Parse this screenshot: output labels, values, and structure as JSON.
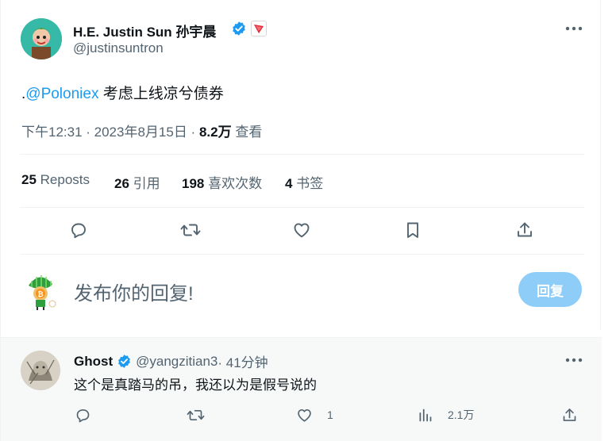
{
  "tweet": {
    "author_name": "H.E. Justin Sun 孙宇晨",
    "handle": "@justinsuntron",
    "text_prefix": ".",
    "mention": "@Poloniex",
    "text_rest": " 考虑上线凉兮债券",
    "time": "下午12:31 · 2023年8月15日 · ",
    "views_count": "8.2万",
    "views_label": " 查看",
    "more_icon": "more-horizontal-icon",
    "verified_color": "#1d9bf0",
    "affiliate_color": "#e5202e"
  },
  "stats": {
    "reposts_count": "25",
    "reposts_label": " Reposts",
    "quotes_count": "26",
    "quotes_label": " 引用",
    "likes_count": "198",
    "likes_label": " 喜欢次数",
    "bookmarks_count": "4",
    "bookmarks_label": " 书签"
  },
  "actions": [
    "reply-icon",
    "retweet-icon",
    "like-icon",
    "bookmark-icon",
    "share-icon"
  ],
  "composer": {
    "placeholder": "发布你的回复!",
    "button_label": "回复",
    "button_color": "#8ecdf8"
  },
  "reply": {
    "author_name": "Ghost",
    "handle": "@yangzitian3",
    "time": " · 41分钟",
    "text": "这个是真踏马的吊，我还以为是假号说的",
    "likes": "1",
    "views": "2.1万"
  },
  "colors": {
    "accent": "#1d9bf0",
    "muted": "#536471",
    "text": "#0f1419"
  }
}
